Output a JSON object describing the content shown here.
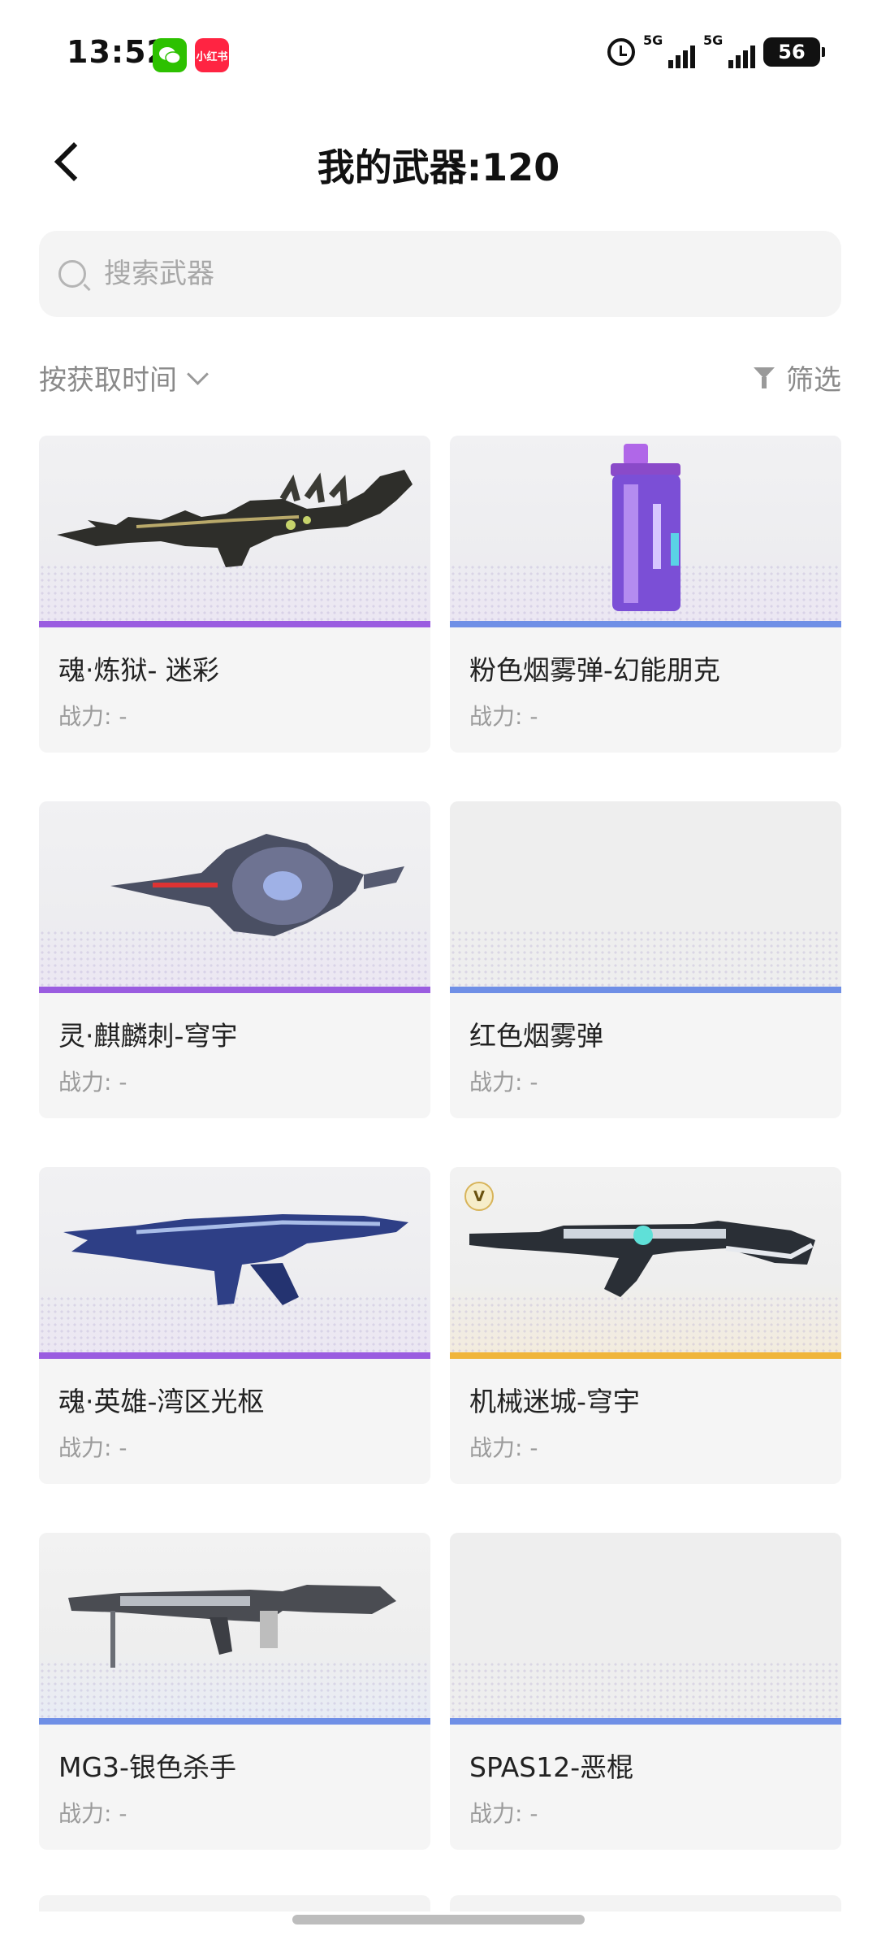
{
  "status_bar": {
    "time": "13:52",
    "apps": [
      "微信",
      "小红书"
    ],
    "signal_1": "5G",
    "signal_2": "5G",
    "battery": "56"
  },
  "header": {
    "title": "我的武器:120"
  },
  "search": {
    "placeholder": "搜索武器"
  },
  "toolbar": {
    "sort_label": "按获取时间",
    "filter_label": "筛选"
  },
  "weapons": [
    {
      "name": "魂·炼狱- 迷彩",
      "power": "战力: -",
      "accent": "#9a5ce0",
      "icon": "dragon-rifle"
    },
    {
      "name": "粉色烟雾弹-幻能朋克",
      "power": "战力: -",
      "accent": "#6f8fe6",
      "icon": "smoke-grenade"
    },
    {
      "name": "灵·麒麟刺-穹宇",
      "power": "战力: -",
      "accent": "#9a5ce0",
      "icon": "qilin-spear"
    },
    {
      "name": "红色烟雾弹",
      "power": "战力: -",
      "accent": "#6f8fe6",
      "icon": "none"
    },
    {
      "name": "魂·英雄-湾区光枢",
      "power": "战力: -",
      "accent": "#9a5ce0",
      "icon": "blue-rifle"
    },
    {
      "name": "机械迷城-穹宇",
      "power": "战力: -",
      "accent": "#f0b53c",
      "icon": "ak-rifle",
      "badge": "V"
    },
    {
      "name": "MG3-银色杀手",
      "power": "战力: -",
      "accent": "#6f8fe6",
      "icon": "machine-gun"
    },
    {
      "name": "SPAS12-恶棍",
      "power": "战力: -",
      "accent": "#6f8fe6",
      "icon": "none"
    }
  ]
}
